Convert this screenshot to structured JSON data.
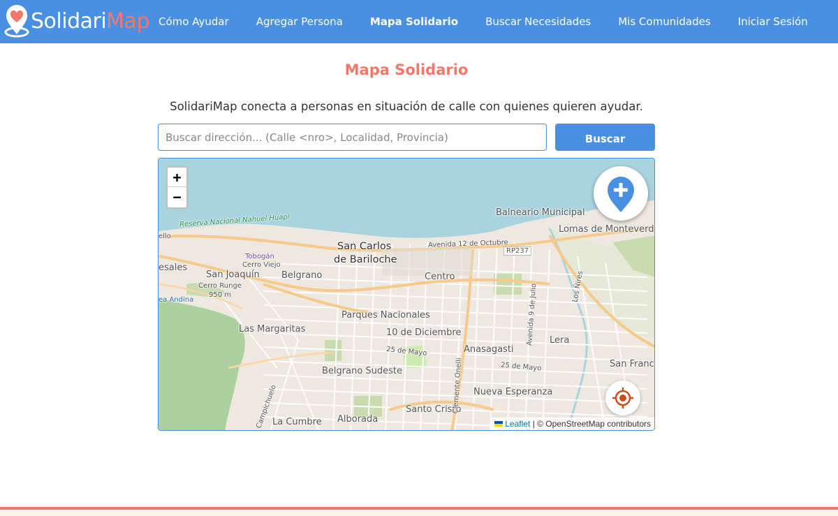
{
  "brand": {
    "part1": "Solidari",
    "part2": "Map"
  },
  "nav": {
    "items": [
      {
        "label": "Cómo Ayudar",
        "active": false
      },
      {
        "label": "Agregar Persona",
        "active": false
      },
      {
        "label": "Mapa Solidario",
        "active": true
      },
      {
        "label": "Buscar Necesidades",
        "active": false
      },
      {
        "label": "Mis Comunidades",
        "active": false
      },
      {
        "label": "Iniciar Sesión",
        "active": false
      }
    ]
  },
  "page": {
    "title": "Mapa Solidario",
    "subtitle": "SolidariMap conecta a personas en situación de calle con quienes quieren ayudar."
  },
  "search": {
    "placeholder": "Buscar dirección... (Calle <nro>, Localidad, Provincia)",
    "value": "",
    "button_label": "Buscar"
  },
  "map": {
    "zoom_in": "+",
    "zoom_out": "−",
    "labels": {
      "san_carlos_1": "San Carlos",
      "san_carlos_2": "de Bariloche",
      "balneario": "Balneario Municipal",
      "lomas": "Lomas de Monteverd",
      "reserva": "Reserva Nacional Nahuel Huapi",
      "avenida": "Avenida 12 de Octubre",
      "rp237": "RP237",
      "tobogan": "Tobogán",
      "cerro_viejo": "Cerro Viejo",
      "sesales": "esales",
      "san_joaquin": "San Joaquín",
      "belgrano": "Belgrano",
      "centro": "Centro",
      "cerro_runge": "Cerro Runge",
      "cerro_runge_alt": "950 m",
      "ea_andina": "ea Andina",
      "parques": "Parques Nacionales",
      "las_margaritas": "Las Margaritas",
      "diez_dic": "10 de Diciembre",
      "mayo_1": "25 de Mayo",
      "mayo_2": "25 de Mayo",
      "anasagasti": "Anasagasti",
      "lera": "Lera",
      "san_franc": "San Franc",
      "belgrano_sud": "Belgrano Sudeste",
      "nueva_esp": "Nueva Esperanza",
      "santo_cristo": "Santo Cristo",
      "alborada": "Alborada",
      "la_cumbre": "La Cumbre",
      "clemente": "Clemente Onelli",
      "av9": "Avenida 9 de Julio",
      "campichuelo": "Campichuelo",
      "los_nires": "Los Ñires",
      "ello": "ello"
    },
    "attribution": {
      "leaflet": "Leaflet",
      "separator": " | © ",
      "osm": "OpenStreetMap contributors"
    }
  },
  "colors": {
    "primary": "#4a90e2",
    "accent": "#f3776a",
    "water": "#a9d3df",
    "land": "#eee8e0"
  }
}
